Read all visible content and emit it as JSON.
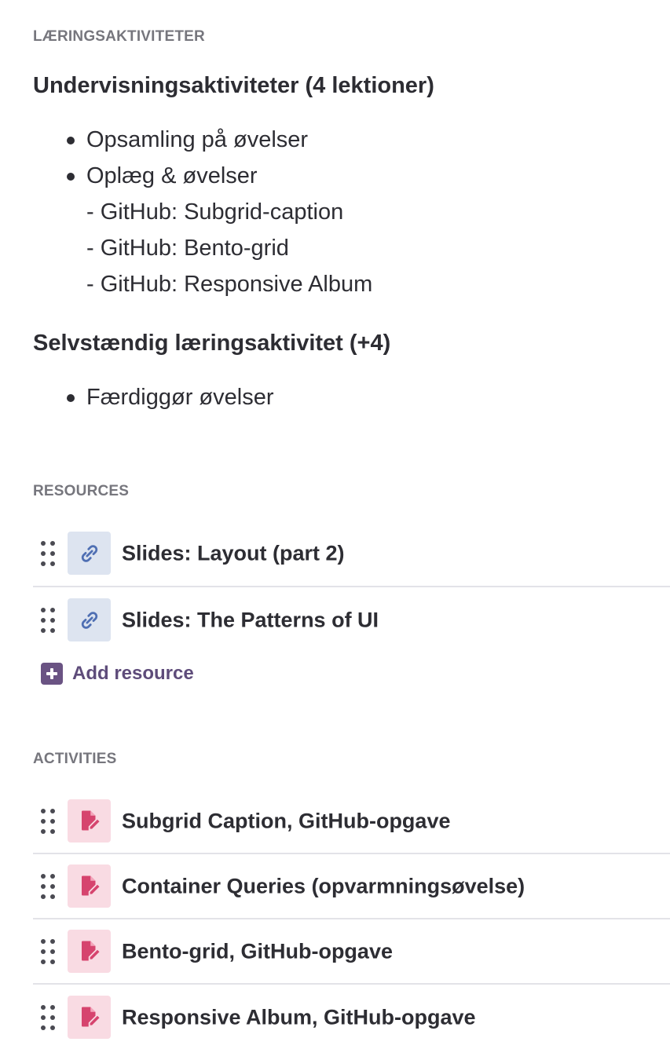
{
  "learning": {
    "label": "LÆRINGSAKTIVITETER",
    "teaching_heading": "Undervisningsaktiviteter (4 lektioner)",
    "teaching_items": [
      {
        "text": "Opsamling på øvelser",
        "subs": []
      },
      {
        "text": "Oplæg & øvelser",
        "subs": [
          "- GitHub: Subgrid-caption",
          "- GitHub: Bento-grid",
          "- GitHub: Responsive Album"
        ]
      }
    ],
    "self_heading": "Selvstændig læringsaktivitet (+4)",
    "self_items": [
      {
        "text": "Færdiggør øvelser"
      }
    ]
  },
  "resources": {
    "label": "RESOURCES",
    "items": [
      {
        "title": "Slides: Layout (part 2)",
        "icon": "link-icon"
      },
      {
        "title": "Slides: The Patterns of UI",
        "icon": "link-icon"
      }
    ],
    "add_label": "Add resource"
  },
  "activities": {
    "label": "ACTIVITIES",
    "items": [
      {
        "title": "Subgrid Caption, GitHub-opgave",
        "icon": "assignment-icon"
      },
      {
        "title": "Container Queries (opvarmningsøvelse)",
        "icon": "assignment-icon"
      },
      {
        "title": "Bento-grid, GitHub-opgave",
        "icon": "assignment-icon"
      },
      {
        "title": "Responsive Album, GitHub-opgave",
        "icon": "assignment-icon"
      }
    ]
  },
  "colors": {
    "text": "#2d2d33",
    "muted": "#76767d",
    "link_tile": "#dde4f0",
    "link_icon": "#4f6fb3",
    "activity_tile": "#f9dbe3",
    "activity_icon": "#d6446e",
    "accent": "#6a5383"
  }
}
